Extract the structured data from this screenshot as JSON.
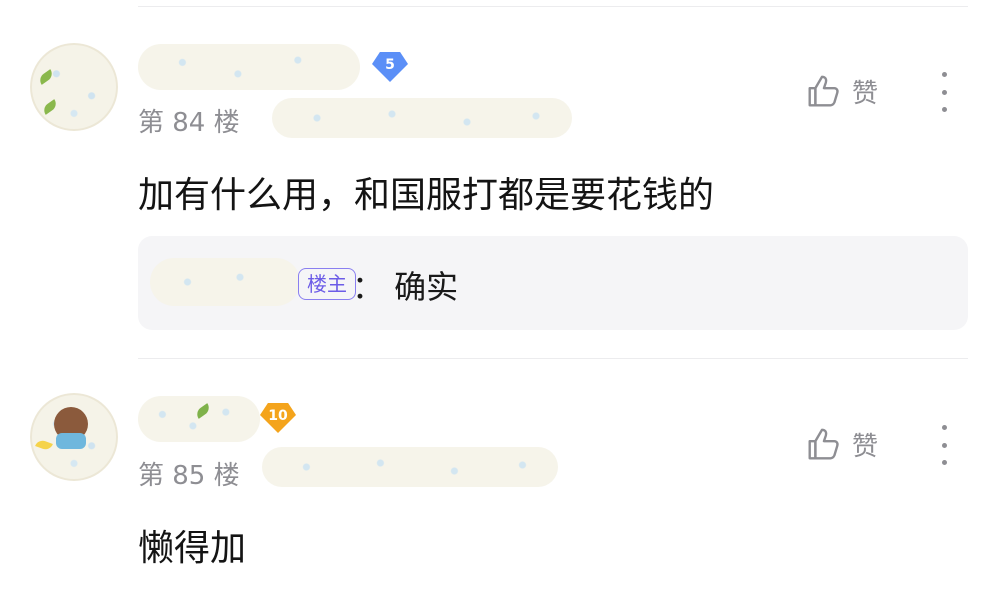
{
  "posts": [
    {
      "floor": "第 84 楼",
      "level": "5",
      "content": "加有什么用，和国服打都是要花钱的",
      "like_label": "赞",
      "reply": {
        "op_tag": "楼主",
        "text": "：  确实"
      }
    },
    {
      "floor": "第 85 楼",
      "level": "10",
      "content": "懒得加",
      "like_label": "赞"
    }
  ],
  "colors": {
    "badge_level_5": "#5b8ff7",
    "badge_level_10": "#f4a41c",
    "op_tag": "#6c5ce7",
    "muted_text": "#8e8e93"
  }
}
